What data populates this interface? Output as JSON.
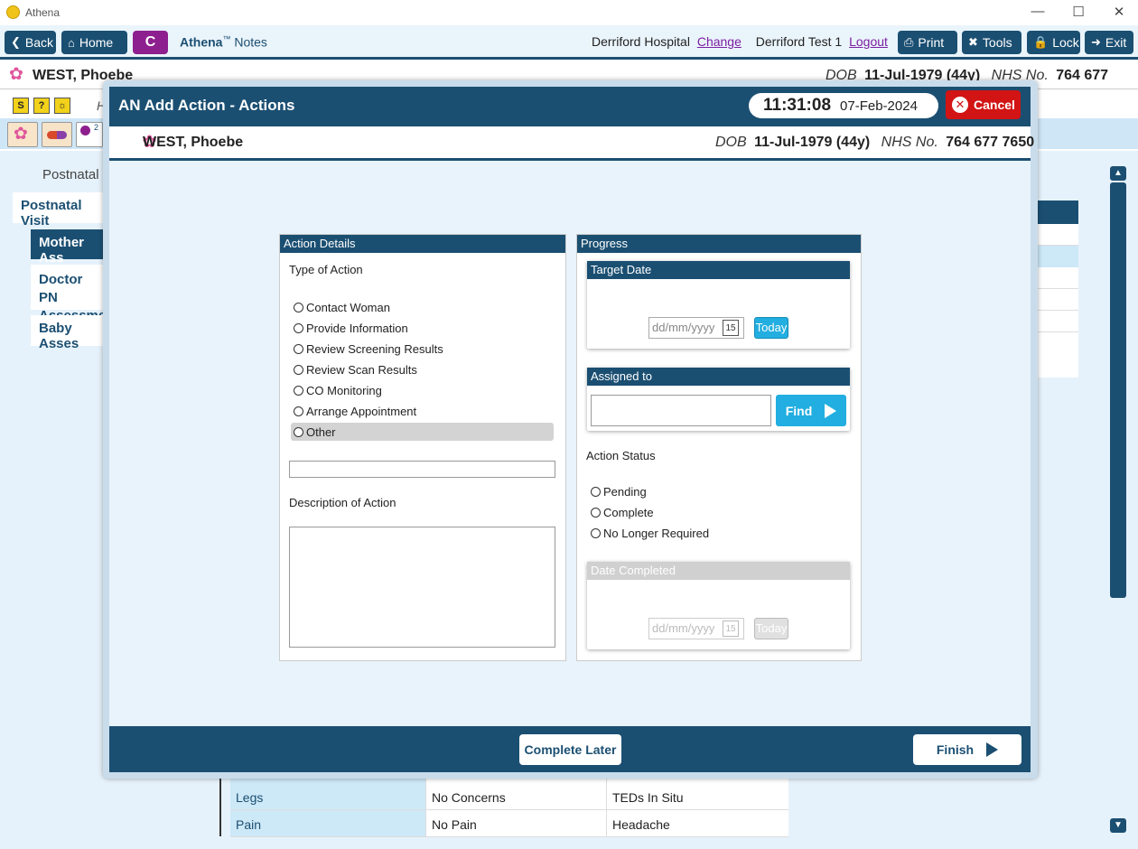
{
  "window": {
    "title": "Athena",
    "controls": [
      "—",
      "☐",
      "✕"
    ]
  },
  "toolbar": {
    "back": "Back",
    "home": "Home",
    "c_label": "C",
    "brand": "Athena",
    "brand_tm": "™",
    "brand_sub": "Notes",
    "hospital": "Derriford Hospital",
    "change": "Change",
    "user": "Derriford Test 1",
    "logout": "Logout",
    "print": "Print",
    "tools": "Tools",
    "lock": "Lock",
    "exit": "Exit"
  },
  "patient": {
    "name": "WEST, Phoebe",
    "dob_label": "DOB",
    "dob": "11-Jul-1979 (44y)",
    "nhs_label": "NHS No.",
    "nhs": "764 677 7650"
  },
  "background": {
    "strip_letter": "H",
    "icon_badge": "2",
    "section": "Postnatal",
    "tabs": [
      "Postnatal Visit",
      "Mother Ass",
      "Doctor PN",
      "Assessmen",
      "Baby Asses"
    ],
    "table": [
      {
        "c1": "Legs",
        "c2": "No Concerns",
        "c3": "TEDs In Situ"
      },
      {
        "c1": "Pain",
        "c2": "No Pain",
        "c3": "Headache"
      }
    ]
  },
  "modal": {
    "title": "AN Add Action - Actions",
    "time": "11:31:08",
    "date": "07-Feb-2024",
    "cancel": "Cancel",
    "action_details": {
      "header": "Action Details",
      "type_label": "Type of Action",
      "options": [
        "Contact Woman",
        "Provide Information",
        "Review Screening Results",
        "Review Scan Results",
        "CO Monitoring",
        "Arrange Appointment",
        "Other"
      ],
      "other_value": "",
      "description_label": "Description of Action",
      "description_value": ""
    },
    "progress": {
      "header": "Progress",
      "target_date": {
        "header": "Target Date",
        "placeholder": "dd/mm/yyyy",
        "cal": "15",
        "today": "Today"
      },
      "assigned_to": {
        "header": "Assigned to",
        "value": "",
        "find": "Find"
      },
      "status_label": "Action Status",
      "status_options": [
        "Pending",
        "Complete",
        "No Longer Required"
      ],
      "date_completed": {
        "header": "Date Completed",
        "placeholder": "dd/mm/yyyy",
        "cal": "15",
        "today": "Today"
      }
    },
    "complete_later": "Complete Later",
    "finish": "Finish"
  }
}
